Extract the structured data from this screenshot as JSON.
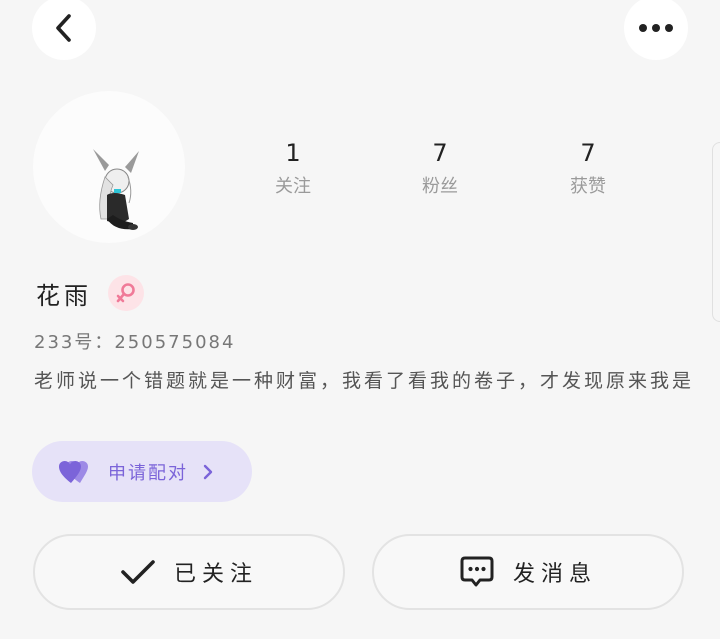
{
  "header": {
    "back_icon": "chevron-left-icon",
    "more_icon": "more-horizontal-icon"
  },
  "stats": [
    {
      "value": "1",
      "label": "关注"
    },
    {
      "value": "7",
      "label": "粉丝"
    },
    {
      "value": "7",
      "label": "获赞"
    }
  ],
  "profile": {
    "name": "花雨",
    "gender_icon": "female-symbol-icon",
    "uid_label": "233号：",
    "uid": "250575084",
    "bio": "老师说一个错题就是一种财富，我看了看我的卷子，才发现原来我是"
  },
  "match": {
    "label": "申请配对",
    "icon": "heart-pair-icon"
  },
  "actions": {
    "followed_label": "已关注",
    "message_label": "发消息"
  },
  "colors": {
    "background": "#f6f6f6",
    "accent_purple": "#7b64d9",
    "match_bg": "#e6e2f8",
    "gender_pink": "#f07a98"
  }
}
